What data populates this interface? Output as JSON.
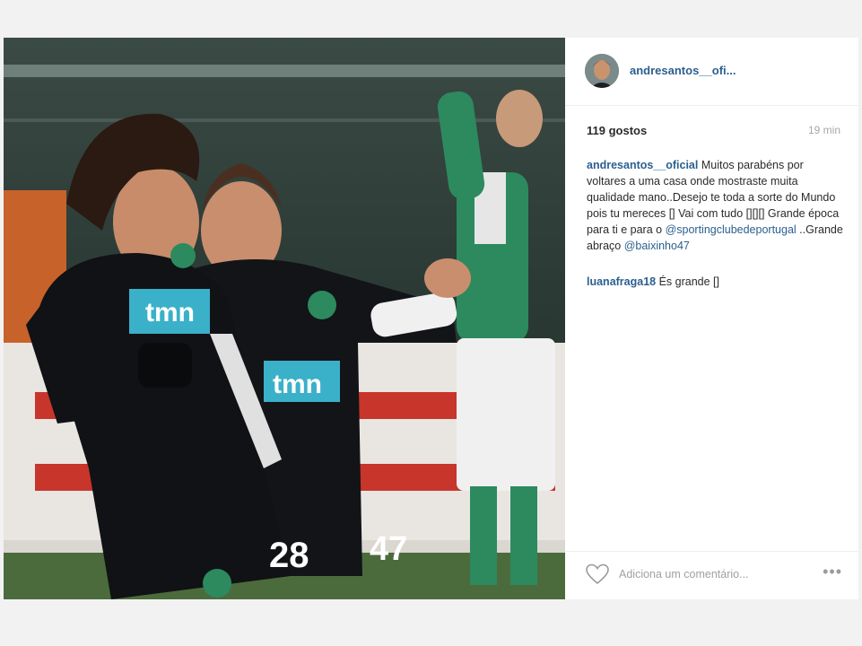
{
  "post": {
    "username": "andresantos__ofi...",
    "likes": "119 gostos",
    "time": "19 min",
    "caption": {
      "author": "andresantos__oficial",
      "text_1": " Muitos parabéns por voltares a uma casa onde mostraste muita qualidade mano..Desejo te toda a sorte do Mundo pois tu mereces [] Vai com tudo [][][] Grande época para ti e para o ",
      "mention_1": "@sportingclubedeportugal",
      "text_2": " ..Grande abraço ",
      "mention_2": "@baixinho47"
    },
    "comments": [
      {
        "author": "luanafraga18",
        "text": " És grande []"
      }
    ],
    "comment_placeholder": "Adiciona um comentário...",
    "more_label": "•••"
  },
  "photo": {
    "sponsor_text": "tmn",
    "shirt_numbers": [
      "28",
      "47"
    ]
  },
  "colors": {
    "link": "#2b5f8f",
    "muted": "#a7a7a7"
  }
}
